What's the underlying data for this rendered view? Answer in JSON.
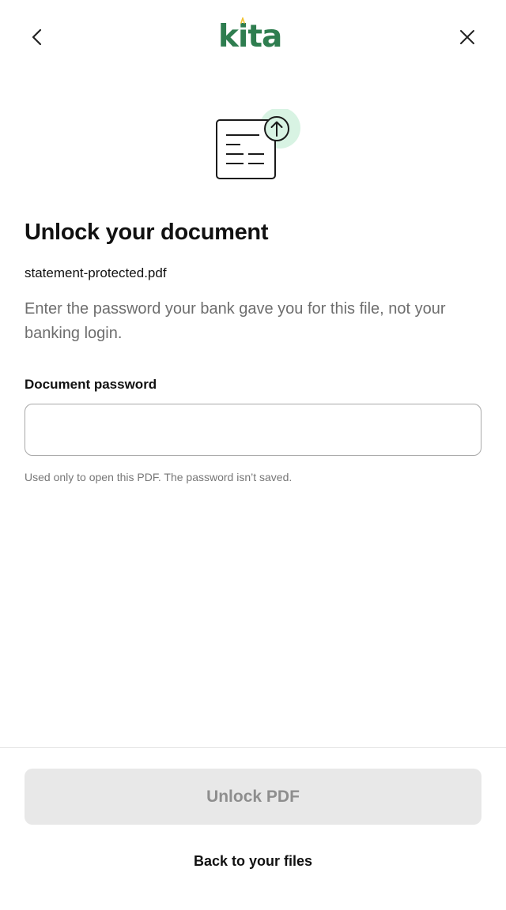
{
  "header": {
    "back_icon": "chevron-left-icon",
    "close_icon": "close-icon",
    "logo_prefix": "k",
    "logo_i": "i",
    "logo_suffix": "ta",
    "logo_color": "#2e7d4f",
    "logo_accent_color": "#f2c230"
  },
  "illustration": {
    "icon": "document-upload-icon",
    "accent_color": "#d8f3e3"
  },
  "content": {
    "title": "Unlock your document",
    "filename": "statement-protected.pdf",
    "description": "Enter the password your bank gave you for this file, not your banking login.",
    "field_label": "Document password",
    "password_value": "",
    "helper_text": "Used only to open this PDF. The password isn’t saved."
  },
  "footer": {
    "unlock_label": "Unlock PDF",
    "unlock_disabled": true,
    "back_link": "Back to your files"
  }
}
